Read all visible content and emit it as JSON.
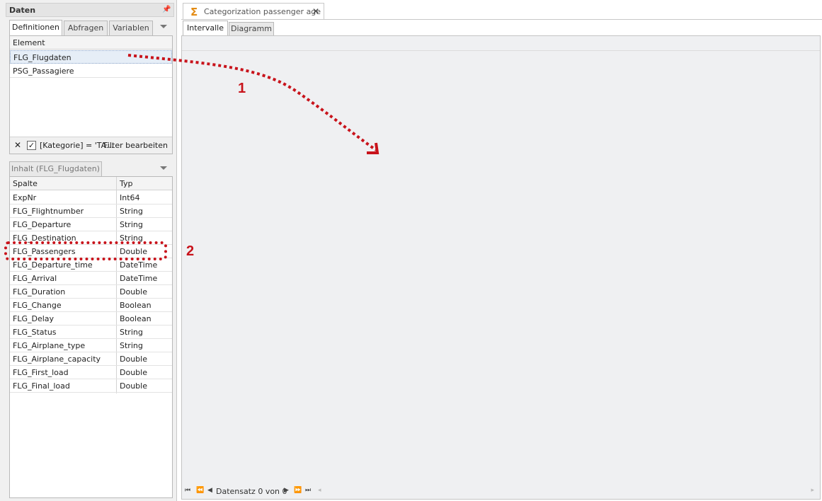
{
  "left_panel": {
    "title": "Daten",
    "tabs": [
      "Definitionen",
      "Abfragen",
      "Variablen"
    ],
    "definitions": {
      "header": "Element",
      "items": [
        "FLG_Flugdaten",
        "PSG_Passagiere"
      ],
      "selected_index": 0
    },
    "filter": {
      "expression": "[Kategorie] = 'TA...",
      "edit_label": "Filter bearbeiten",
      "checked": true
    },
    "content_tab": "Inhalt (FLG_Flugdaten)",
    "columns_header": [
      "Spalte",
      "Typ"
    ],
    "columns": [
      [
        "ExpNr",
        "Int64"
      ],
      [
        "FLG_Flightnumber",
        "String"
      ],
      [
        "FLG_Departure",
        "String"
      ],
      [
        "FLG_Destination",
        "String"
      ],
      [
        "FLG_Passengers",
        "Double"
      ],
      [
        "FLG_Departure_time",
        "DateTime"
      ],
      [
        "FLG_Arrival",
        "DateTime"
      ],
      [
        "FLG_Duration",
        "Double"
      ],
      [
        "FLG_Change",
        "Boolean"
      ],
      [
        "FLG_Delay",
        "Boolean"
      ],
      [
        "FLG_Status",
        "String"
      ],
      [
        "FLG_Airplane_type",
        "String"
      ],
      [
        "FLG_Airplane_capacity",
        "Double"
      ],
      [
        "FLG_First_load",
        "Double"
      ],
      [
        "FLG_Final_load",
        "Double"
      ]
    ]
  },
  "document": {
    "tab_title": "Categorization passenger age",
    "view_tabs": [
      "Intervalle",
      "Diagramm"
    ],
    "record_nav": "Datensatz 0 von 0"
  },
  "annotations": {
    "step1": "1",
    "step2": "2",
    "color": "#c8131b"
  },
  "icons": {
    "doc": "sigma-icon",
    "close": "close-icon",
    "pin": "pin-icon"
  }
}
